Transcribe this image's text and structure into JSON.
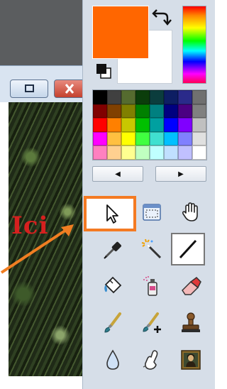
{
  "canvas_area": {
    "annotation_text": "Ici",
    "arrow_color": "#f07e22",
    "window_buttons": [
      {
        "name": "maximize-icon",
        "color": "#d6e3f2"
      },
      {
        "name": "close-icon",
        "color": "#d95645"
      }
    ]
  },
  "colors": {
    "primary": "#ff6600",
    "secondary": "#ffffff"
  },
  "palette": [
    "#000000",
    "#404040",
    "#556b2f",
    "#0b3d0b",
    "#0b3d3d",
    "#0d1e63",
    "#2a2a8a",
    "#707070",
    "#800000",
    "#804000",
    "#808000",
    "#008000",
    "#008080",
    "#000080",
    "#4b0082",
    "#808080",
    "#ff0000",
    "#ff8000",
    "#c8c800",
    "#00c000",
    "#00a0a0",
    "#0000ff",
    "#8000ff",
    "#c0c0c0",
    "#ff00ff",
    "#ffc040",
    "#ffff00",
    "#40ff40",
    "#40e0d0",
    "#00c0ff",
    "#8080ff",
    "#e0e0e0",
    "#ff80c0",
    "#ffd090",
    "#ffff90",
    "#c0ffc0",
    "#c0ffff",
    "#c0e0ff",
    "#c0c0ff",
    "#ffffff"
  ],
  "palette_nav": {
    "prev": "◀",
    "next": "▶"
  },
  "tools": [
    {
      "name": "select-pointer-tool",
      "icon": "pointer-icon",
      "active": true
    },
    {
      "name": "move-selection-tool",
      "icon": "selection-window-icon"
    },
    {
      "name": "pan-tool",
      "icon": "hand-icon"
    },
    {
      "name": "color-picker-tool",
      "icon": "eyedropper-icon"
    },
    {
      "name": "magic-wand-tool",
      "icon": "magic-wand-icon"
    },
    {
      "name": "line-tool",
      "icon": "line-icon",
      "selected": true
    },
    {
      "name": "paint-bucket-tool",
      "icon": "paint-bucket-icon"
    },
    {
      "name": "spray-tool",
      "icon": "spray-can-icon"
    },
    {
      "name": "eraser-tool",
      "icon": "eraser-icon"
    },
    {
      "name": "brush-tool",
      "icon": "paintbrush-icon"
    },
    {
      "name": "brush-plus-tool",
      "icon": "paintbrush-plus-icon"
    },
    {
      "name": "stamp-tool",
      "icon": "stamp-icon"
    },
    {
      "name": "blur-tool",
      "icon": "water-drop-icon"
    },
    {
      "name": "smudge-tool",
      "icon": "finger-icon"
    },
    {
      "name": "clone-tool",
      "icon": "mona-lisa-icon"
    }
  ]
}
